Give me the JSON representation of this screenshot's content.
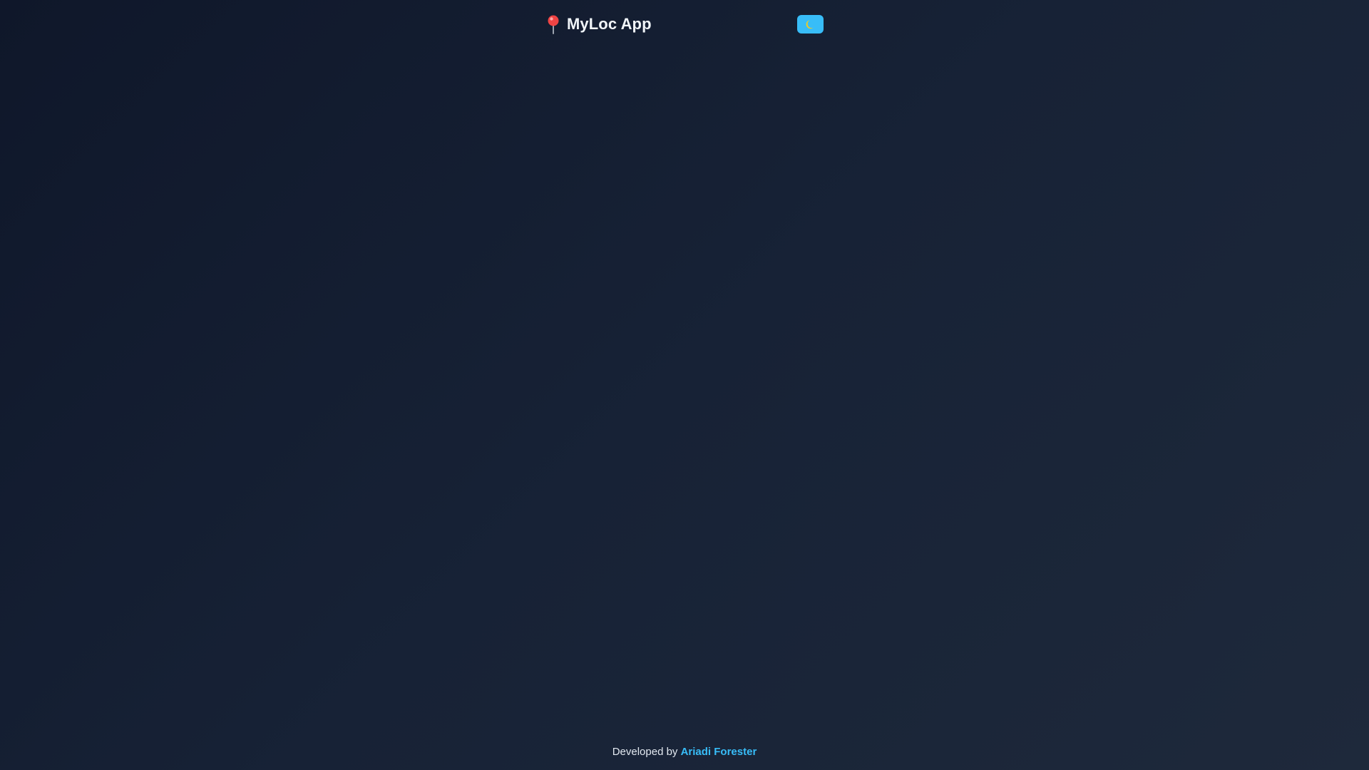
{
  "app": {
    "title": "MyLoc App",
    "logo_icon": "map-pin-icon"
  },
  "theme_toggle": {
    "icon": "moon-icon",
    "color": "#38bdf8"
  },
  "footer": {
    "prefix": "Developed by",
    "author": "Ariadi Forester",
    "link_color": "#38bdf8"
  },
  "colors": {
    "background_start": "#0f172a",
    "background_end": "#1e293b",
    "text": "#f1f5f9",
    "accent": "#38bdf8"
  }
}
